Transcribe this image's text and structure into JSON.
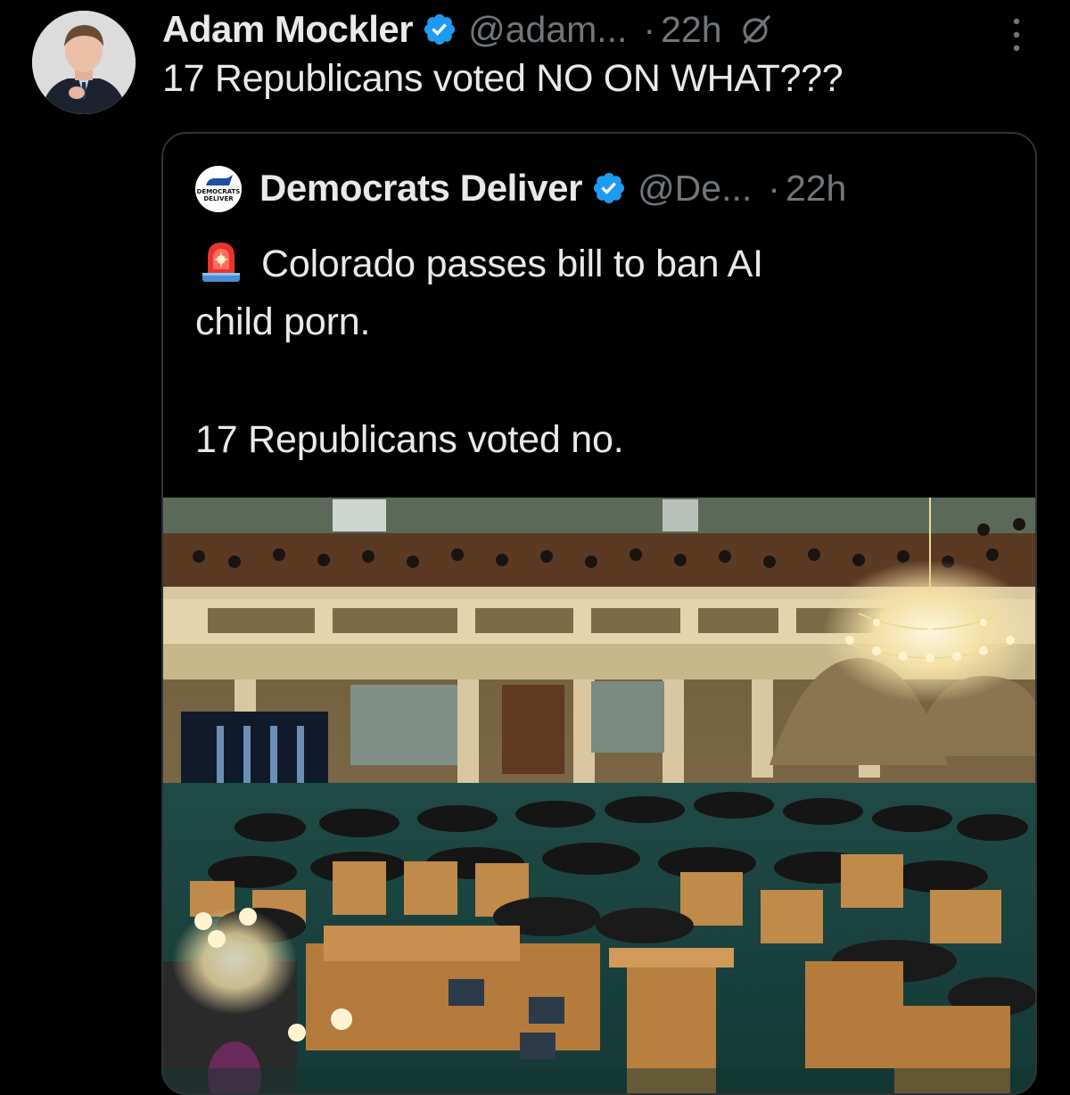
{
  "tweet": {
    "display_name": "Adam Mockler",
    "handle": "@adam...",
    "separator": "·",
    "time": "22h",
    "text": "17 Republicans voted NO ON WHAT???"
  },
  "quote": {
    "display_name": "Democrats Deliver",
    "handle": "@De...",
    "separator": "·",
    "time": "22h",
    "avatar_text_line1": "DEMOCRATS",
    "avatar_text_line2": "DELIVER",
    "line1": "Colorado passes bill to ban AI",
    "line2": "child porn.",
    "line3": "17 Republicans voted no."
  },
  "colors": {
    "background": "#000000",
    "text_primary": "#e7e9ea",
    "text_secondary": "#71767b",
    "verified_blue": "#1d9bf0",
    "card_border": "#2f3336"
  },
  "icons": {
    "verified": "verified-badge-icon",
    "grok": "grok-icon",
    "more": "more-options-icon",
    "siren": "siren-emoji-icon"
  }
}
